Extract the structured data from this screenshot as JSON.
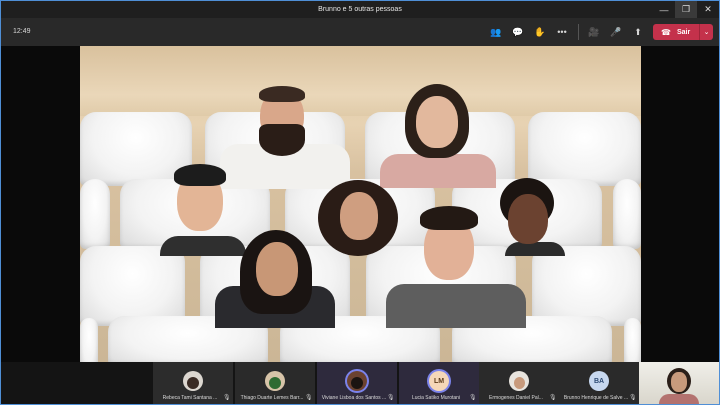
{
  "window": {
    "title": "Brunno e 5 outras pessoas",
    "minimize_glyph": "—",
    "maximize_glyph": "❐",
    "close_glyph": "✕"
  },
  "toolbar": {
    "clock": "12:49",
    "icons": {
      "participants": "👥",
      "chat": "💬",
      "raise_hand": "✋",
      "more": "•••",
      "camera": "🎥",
      "mic": "🎤",
      "share": "⬆"
    },
    "leave_label": "Sair",
    "leave_icon": "☎",
    "leave_chevron": "⌄",
    "leave_color": "#c4314b"
  },
  "participants": [
    {
      "name": "Rebeca Tami Santana ...",
      "avatar_initials": "",
      "ring": false
    },
    {
      "name": "Thiago Duarte Lemes Barr...",
      "avatar_initials": "",
      "ring": false
    },
    {
      "name": "Viviane Lisboa dos Santos ...",
      "avatar_initials": "",
      "ring": true
    },
    {
      "name": "Lucia Satiko Murotani",
      "avatar_initials": "LM",
      "ring": true
    },
    {
      "name": "Ermogenes Daniel Pal...",
      "avatar_initials": "",
      "ring": false
    },
    {
      "name": "Brunno Henrique de Salve ...",
      "avatar_initials": "BA",
      "ring": false
    }
  ],
  "mic_icon_glyph": "🎙"
}
